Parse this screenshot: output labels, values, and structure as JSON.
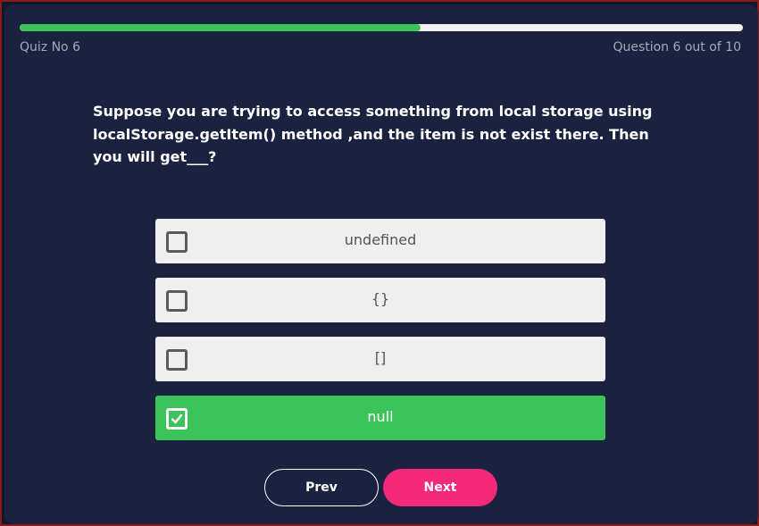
{
  "progress": {
    "fraction": 0.554
  },
  "header": {
    "quiz_label": "Quiz No 6",
    "counter": "Question 6 out of 10"
  },
  "question": {
    "text": "Suppose you are trying to access something from local storage using localStorage.getItem() method ,and the item is not exist there. Then you will get___?"
  },
  "options": [
    {
      "label": "undefined",
      "selected": false
    },
    {
      "label": "{}",
      "selected": false
    },
    {
      "label": "[]",
      "selected": false
    },
    {
      "label": "null",
      "selected": true
    }
  ],
  "nav": {
    "prev_label": "Prev",
    "next_label": "Next"
  },
  "colors": {
    "background": "#1a2240",
    "accent_green": "#3cc35a",
    "accent_pink": "#f5297a",
    "option_bg": "#efefef"
  },
  "icons": {
    "checkbox_checked": "check-icon"
  }
}
